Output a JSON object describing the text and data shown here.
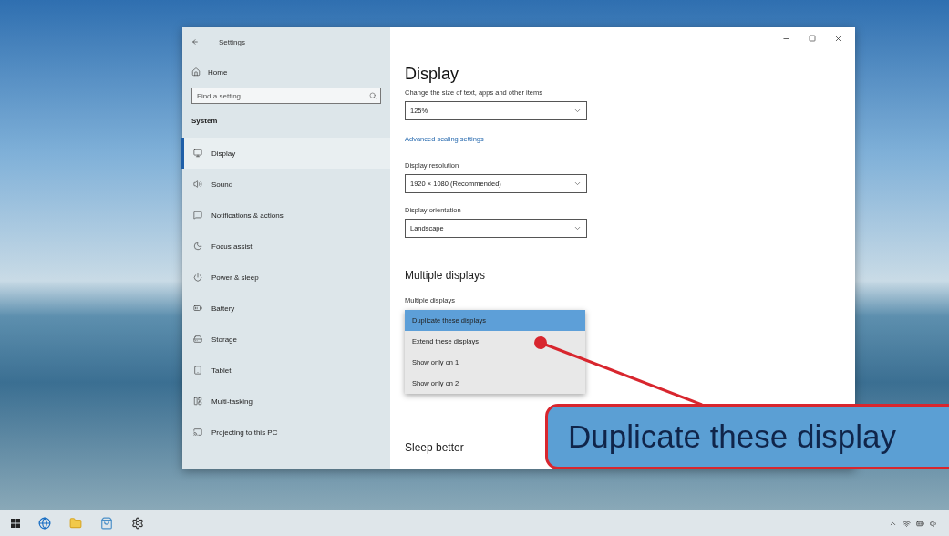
{
  "window": {
    "title": "Settings"
  },
  "sidebar": {
    "home": "Home",
    "search": {
      "placeholder": "Find a setting"
    },
    "section": "System",
    "items": [
      {
        "label": "Display",
        "selected": true
      },
      {
        "label": "Sound",
        "selected": false
      },
      {
        "label": "Notifications & actions",
        "selected": false
      },
      {
        "label": "Focus assist",
        "selected": false
      },
      {
        "label": "Power & sleep",
        "selected": false
      },
      {
        "label": "Battery",
        "selected": false
      },
      {
        "label": "Storage",
        "selected": false
      },
      {
        "label": "Tablet",
        "selected": false
      },
      {
        "label": "Multi-tasking",
        "selected": false
      },
      {
        "label": "Projecting to this PC",
        "selected": false
      }
    ]
  },
  "content": {
    "title": "Display",
    "scale": {
      "label": "Change the size of text, apps and other items",
      "value": "125%"
    },
    "link": "Advanced scaling settings",
    "resolution": {
      "label": "Display resolution",
      "value": "1920 × 1080 (Recommended)"
    },
    "orientation": {
      "label": "Display orientation",
      "value": "Landscape"
    },
    "multiple_heading": "Multiple displays",
    "multiple_label": "Multiple displays",
    "multiple_options": [
      {
        "label": "Duplicate these displays",
        "selected": true
      },
      {
        "label": "Extend these displays",
        "selected": false
      },
      {
        "label": "Show only on 1",
        "selected": false
      },
      {
        "label": "Show only on 2",
        "selected": false
      }
    ],
    "sleep_heading": "Sleep better"
  },
  "callout": {
    "text": "Duplicate these display"
  }
}
